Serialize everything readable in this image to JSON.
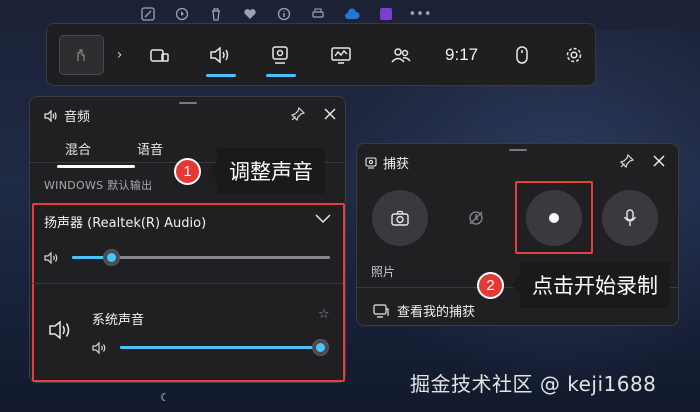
{
  "top_strip": {
    "icons": [
      "edit-icon",
      "pointer-icon",
      "trash-icon",
      "heart-icon",
      "info-icon",
      "print-icon",
      "cloud-icon",
      "app-icon",
      "more-icon"
    ]
  },
  "gamebar": {
    "time": "9:17",
    "buttons": [
      "widget-icon",
      "audio-icon",
      "capture-icon",
      "performance-icon",
      "social-icon"
    ],
    "active": [
      "audio",
      "capture"
    ]
  },
  "audio": {
    "title": "音频",
    "tabs": [
      "混合",
      "语音"
    ],
    "active_tab": 0,
    "section_label": "WINDOWS 默认输出",
    "device": "扬声器 (Realtek(R) Audio)",
    "device_volume": 0.15,
    "app_name": "系统声音",
    "app_volume": 1.0
  },
  "capture": {
    "title": "捕获",
    "photo_label": "照片",
    "gallery_link": "查看我的捕获"
  },
  "callouts": [
    {
      "number": "1",
      "text": "调整声音"
    },
    {
      "number": "2",
      "text": "点击开始录制"
    }
  ],
  "watermark": "掘金技术社区 @ keji1688",
  "colors": {
    "accent": "#4cc2ff",
    "highlight": "#e54040",
    "panel": "#202023"
  }
}
